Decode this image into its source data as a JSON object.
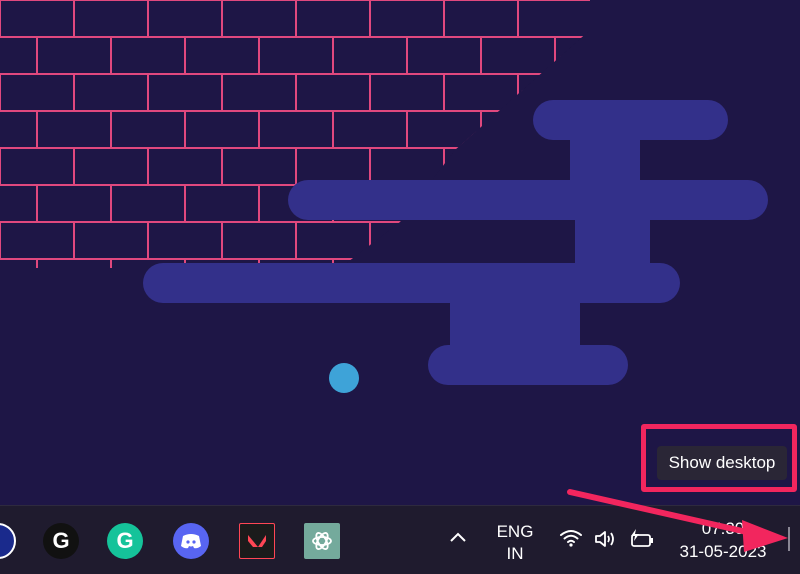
{
  "desktop": {
    "tooltip": "Show desktop"
  },
  "taskbar": {
    "apps": [
      {
        "name": "logitech-g-hub",
        "glyph": "G"
      },
      {
        "name": "grammarly",
        "glyph": "G"
      },
      {
        "name": "discord",
        "glyph": ""
      },
      {
        "name": "valorant",
        "glyph": ""
      },
      {
        "name": "chatgpt",
        "glyph": ""
      }
    ],
    "tray": {
      "chevron": "^",
      "language": "ENG",
      "region": "IN",
      "wifi_icon": "wifi-icon",
      "volume_icon": "volume-icon",
      "battery_icon": "battery-icon",
      "time": "07:30",
      "date": "31-05-2023"
    }
  },
  "colors": {
    "wallpaper_bg": "#1e1646",
    "scallop": "#e0487e",
    "cloud": "#33308a",
    "orb": "#3ea3d8",
    "annotation": "#f2265e"
  }
}
